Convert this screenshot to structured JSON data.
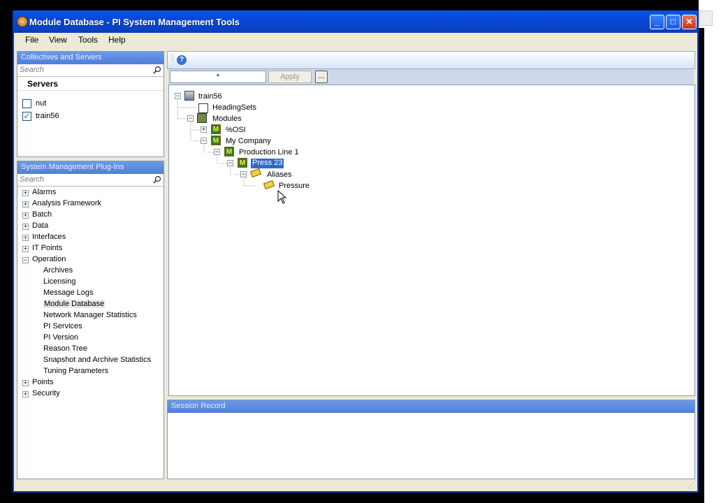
{
  "window": {
    "title": "Module Database - PI System Management Tools"
  },
  "menu": [
    "File",
    "View",
    "Tools",
    "Help"
  ],
  "collectives": {
    "header": "Collectives and Servers",
    "search_placeholder": "Search",
    "column": "Servers",
    "servers": [
      {
        "name": "nut",
        "checked": false
      },
      {
        "name": "train56",
        "checked": true
      }
    ]
  },
  "plugins": {
    "header": "System Management Plug-Ins",
    "search_placeholder": "Search",
    "items": [
      {
        "label": "Alarms",
        "level": 0,
        "expander": "+"
      },
      {
        "label": "Analysis Framework",
        "level": 0,
        "expander": "+"
      },
      {
        "label": "Batch",
        "level": 0,
        "expander": "+"
      },
      {
        "label": "Data",
        "level": 0,
        "expander": "+"
      },
      {
        "label": "Interfaces",
        "level": 0,
        "expander": "+"
      },
      {
        "label": "IT Points",
        "level": 0,
        "expander": "+"
      },
      {
        "label": "Operation",
        "level": 0,
        "expander": "−"
      },
      {
        "label": "Archives",
        "level": 1
      },
      {
        "label": "Licensing",
        "level": 1
      },
      {
        "label": "Message Logs",
        "level": 1
      },
      {
        "label": "Module Database",
        "level": 1,
        "active": true
      },
      {
        "label": "Network Manager Statistics",
        "level": 1
      },
      {
        "label": "PI Services",
        "level": 1
      },
      {
        "label": "PI Version",
        "level": 1
      },
      {
        "label": "Reason Tree",
        "level": 1
      },
      {
        "label": "Snapshot and Archive Statistics",
        "level": 1
      },
      {
        "label": "Tuning Parameters",
        "level": 1
      },
      {
        "label": "Points",
        "level": 0,
        "expander": "+"
      },
      {
        "label": "Security",
        "level": 0,
        "expander": "+"
      }
    ]
  },
  "filter": {
    "value": "*",
    "apply": "Apply",
    "browse": "..."
  },
  "tree": {
    "server": "train56",
    "headingsets": "HeadingSets",
    "modules": "Modules",
    "osi": "%OSI",
    "company": "My Company",
    "line": "Production Line 1",
    "press": "Press 23",
    "aliases": "Aliases",
    "pressure": "Pressure"
  },
  "session": {
    "header": "Session Record"
  },
  "help_icon": "help-icon"
}
